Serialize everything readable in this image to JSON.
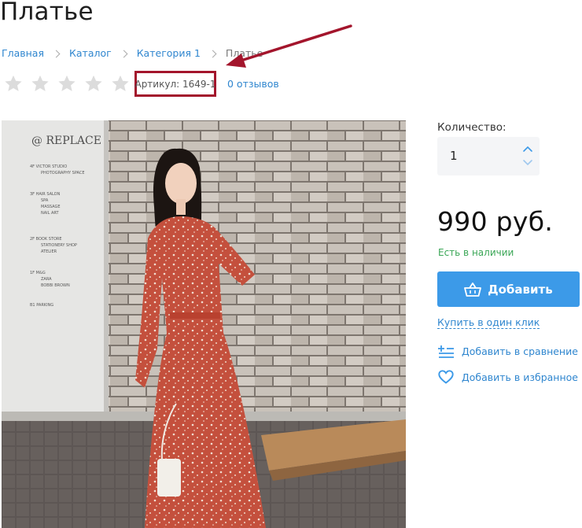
{
  "page": {
    "title": "Платье"
  },
  "breadcrumb": [
    {
      "label": "Главная"
    },
    {
      "label": "Каталог"
    },
    {
      "label": "Категория 1"
    },
    {
      "label": "Платье"
    }
  ],
  "rating": {
    "stars_total": 5,
    "stars_filled": 0
  },
  "sku": {
    "label": "Артикул:",
    "value": "1649-1"
  },
  "reviews": {
    "label": "0 отзывов"
  },
  "photo": {
    "alt": "Платье",
    "sign_title": "@ REPLACE",
    "sign_lines": [
      "4F  VICTOR STUDIO",
      "PHOTOGRAPHY SPACE",
      "3F  HAIR SALON",
      "SPA",
      "MASSAGE",
      "NAIL ART",
      "2F  BOOK STORE",
      "STATIONERY SHOP",
      "ATELIER",
      "1F  M&G",
      "ZARA",
      "BOBBI BROWN",
      "B1  PARKING"
    ]
  },
  "quantity": {
    "label": "Количество:",
    "value": "1"
  },
  "price": {
    "text": "990 руб."
  },
  "stock": {
    "text": "Есть в наличии"
  },
  "buttons": {
    "add_to_cart": "Добавить",
    "one_click": "Купить в один клик",
    "compare": "Добавить в сравнение",
    "favorite": "Добавить в избранное"
  },
  "colors": {
    "link": "#2f86cf",
    "accent": "#3c9ae8",
    "in_stock": "#3aa656",
    "highlight": "#a3152c"
  },
  "icons": {
    "star": "star-outline-icon",
    "cart": "basket-icon",
    "compare": "compare-list-icon",
    "favorite": "heart-outline-icon"
  }
}
